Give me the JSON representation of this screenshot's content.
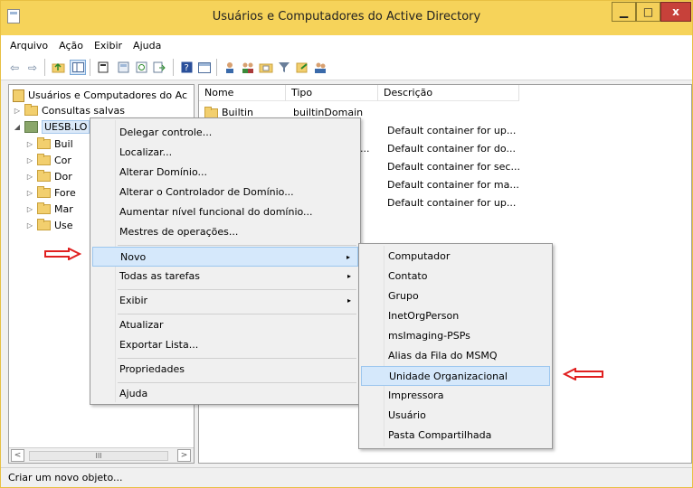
{
  "window": {
    "title": "Usuários e Computadores do Active Directory",
    "minimize": "▁",
    "maximize": "□",
    "close": "x"
  },
  "menubar": [
    "Arquivo",
    "Ação",
    "Exibir",
    "Ajuda"
  ],
  "toolbar_icons": [
    "back-arrow-icon",
    "forward-arrow-icon",
    "folder-up-icon",
    "show-tree-icon",
    "properties-icon",
    "refresh-icon",
    "export-icon",
    "help-icon",
    "console-icon",
    "new-user-icon",
    "new-group-icon",
    "new-ou-icon",
    "filter-icon",
    "find-icon",
    "add-to-group-icon"
  ],
  "tree": {
    "root": "Usuários e Computadores do Ac",
    "saved_queries": "Consultas salvas",
    "domain": "UESB.LO",
    "children": [
      "Buil",
      "Cor",
      "Dor",
      "Fore",
      "Mar",
      "Use"
    ]
  },
  "scrollbar": {
    "left": "<",
    "thumb": "III",
    "right": ">"
  },
  "list": {
    "columns": [
      "Nome",
      "Tipo",
      "Descrição"
    ],
    "rows": [
      {
        "name": "Builtin",
        "type": "builtinDomain",
        "desc": ""
      },
      {
        "name": "",
        "type": "",
        "desc": "Default container for up..."
      },
      {
        "name": "",
        "type": "...",
        "desc": "Default container for do..."
      },
      {
        "name": "",
        "type": "",
        "desc": "Default container for sec..."
      },
      {
        "name": "",
        "type": "",
        "desc": "Default container for ma..."
      },
      {
        "name": "",
        "type": "",
        "desc": "Default container for up..."
      }
    ]
  },
  "context_menu": {
    "items": [
      "Delegar controle...",
      "Localizar...",
      "Alterar Domínio...",
      "Alterar o Controlador de Domínio...",
      "Aumentar nível funcional do domínio...",
      "Mestres de operações...",
      "Novo",
      "Todas as tarefas",
      "Exibir",
      "Atualizar",
      "Exportar Lista...",
      "Propriedades",
      "Ajuda"
    ],
    "submenu_arrow": "▸"
  },
  "submenu_novo": {
    "items": [
      "Computador",
      "Contato",
      "Grupo",
      "InetOrgPerson",
      "msImaging-PSPs",
      "Alias da Fila do MSMQ",
      "Unidade Organizacional",
      "Impressora",
      "Usuário",
      "Pasta Compartilhada"
    ],
    "highlighted": "Unidade Organizacional"
  },
  "status": "Criar um novo objeto...",
  "colors": {
    "titlebar": "#f6d35a",
    "highlight": "#d5e8fb",
    "annotation_arrow": "#e02020"
  }
}
